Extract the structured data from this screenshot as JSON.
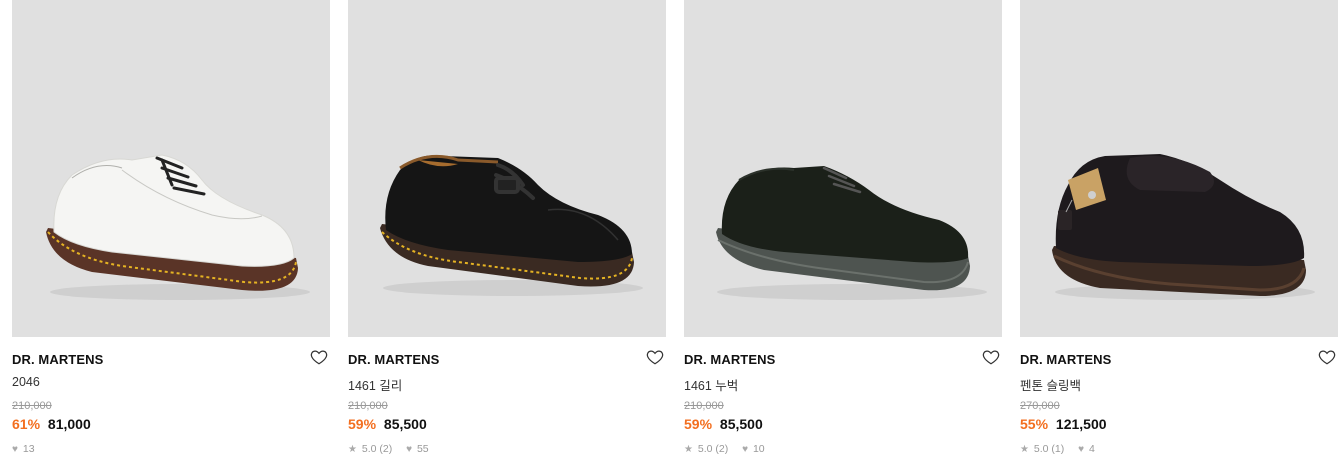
{
  "products": [
    {
      "brand": "DR. MARTENS",
      "name": "2046",
      "original_price": "210,000",
      "discount": "61%",
      "price": "81,000",
      "rating": "",
      "likes": "13",
      "image_icon": "white-derby-shoe-image"
    },
    {
      "brand": "DR. MARTENS",
      "name": "1461 길리",
      "original_price": "210,000",
      "discount": "59%",
      "price": "85,500",
      "rating": "5.0 (2)",
      "likes": "55",
      "image_icon": "black-gillie-shoe-image"
    },
    {
      "brand": "DR. MARTENS",
      "name": "1461 누벅",
      "original_price": "210,000",
      "discount": "59%",
      "price": "85,500",
      "rating": "5.0 (2)",
      "likes": "10",
      "image_icon": "black-nubuck-shoe-image"
    },
    {
      "brand": "DR. MARTENS",
      "name": "펜톤 슬링백",
      "original_price": "270,000",
      "discount": "55%",
      "price": "121,500",
      "rating": "5.0 (1)",
      "likes": "4",
      "image_icon": "slingback-loafer-image"
    }
  ],
  "colors": {
    "discount": "#f36f20",
    "image_bg": "#e0e0e0",
    "muted": "#999999"
  }
}
